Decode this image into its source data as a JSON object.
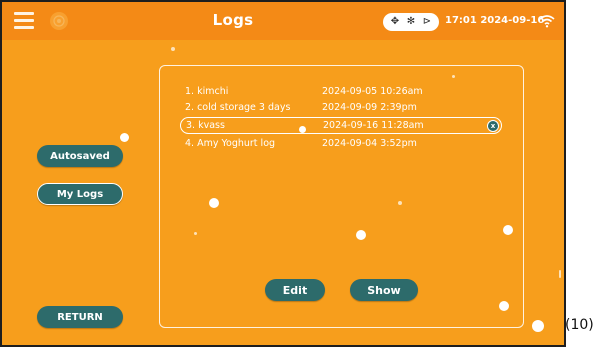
{
  "header": {
    "title": "Logs",
    "clock": "17:01 2024-09-16",
    "mode_icons": [
      "✥",
      "✻",
      "⊳"
    ]
  },
  "sidebar": {
    "autosaved_label": "Autosaved",
    "mylogs_label": "My Logs",
    "return_label": "RETURN"
  },
  "logs": [
    {
      "name": "1. kimchi",
      "date": "2024-09-05 10:26am"
    },
    {
      "name": "2. cold storage 3 days",
      "date": "2024-09-09 2:39pm"
    },
    {
      "name": "3. kvass",
      "date": "2024-09-16 11:28am",
      "selected": true
    },
    {
      "name": "4. Amy Yoghurt log",
      "date": "2024-09-04 3:52pm"
    }
  ],
  "delete_label": "x",
  "actions": {
    "edit_label": "Edit",
    "show_label": "Show"
  },
  "page_number": "(10)",
  "colors": {
    "background": "#f79e1c",
    "topbar": "#f48a16",
    "button": "#2d6b6b",
    "text": "#ffffff"
  },
  "icons": {
    "menu": "hamburger-icon",
    "logo": "logo-icon",
    "wifi": "wifi-icon",
    "delete": "close-icon"
  }
}
